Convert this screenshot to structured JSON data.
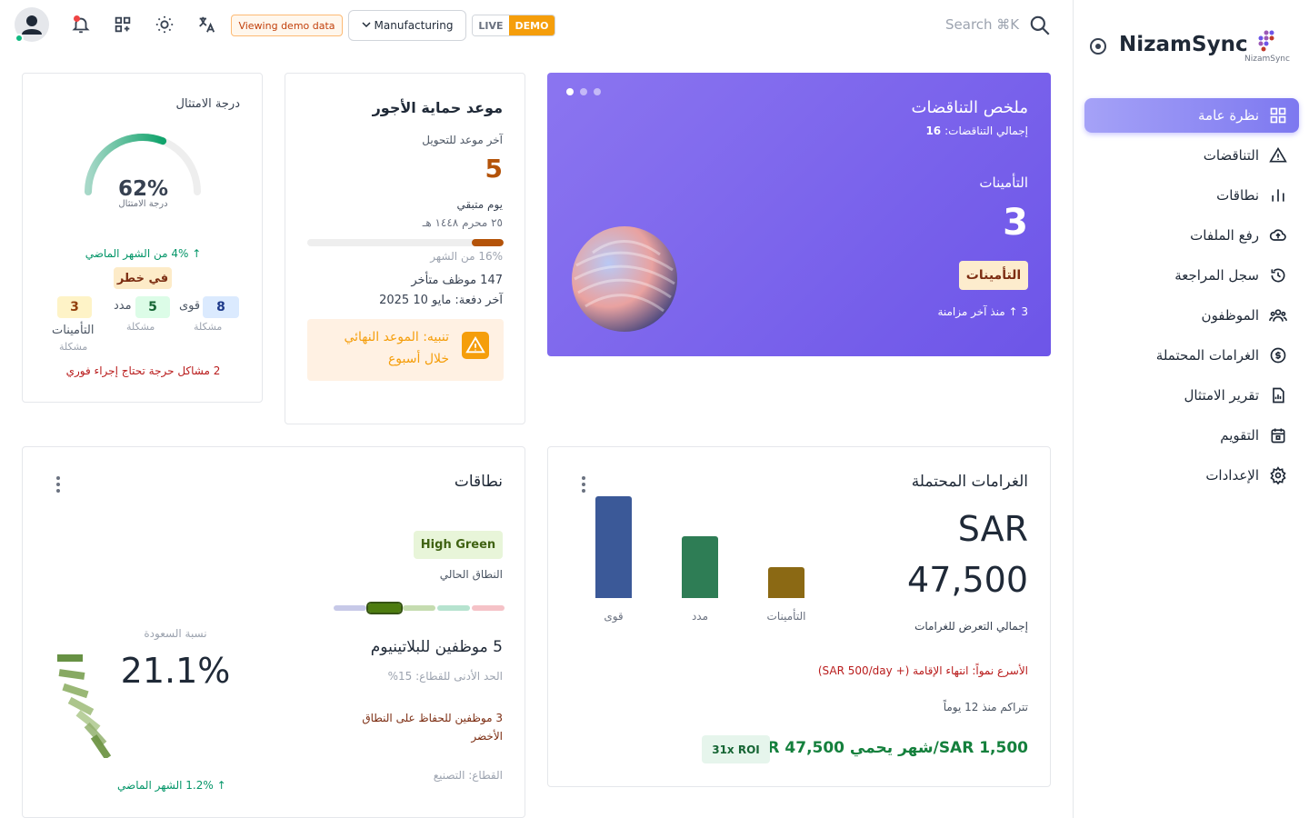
{
  "topbar": {
    "demo_chip": "Viewing demo data",
    "industry": "Manufacturing",
    "mode_live": "LIVE",
    "mode_demo": "DEMO",
    "search_placeholder": "Search ⌘K",
    "icons": [
      "user-icon",
      "bell-icon",
      "apps-icon",
      "sun-icon",
      "translate-icon",
      "search-icon"
    ]
  },
  "sidebar": {
    "brand": "NizamSync",
    "brand_logo_text": "NizamSync",
    "accent": "#7d78f0",
    "items": [
      {
        "label": "نظرة عامة",
        "icon": "dashboard-icon",
        "active": true
      },
      {
        "label": "التناقضات",
        "icon": "warning-icon"
      },
      {
        "label": "نطاقات",
        "icon": "bar-chart-icon"
      },
      {
        "label": "رفع الملفات",
        "icon": "cloud-upload-icon"
      },
      {
        "label": "سجل المراجعة",
        "icon": "history-icon"
      },
      {
        "label": "الموظفون",
        "icon": "users-icon"
      },
      {
        "label": "الغرامات المحتملة",
        "icon": "coin-icon"
      },
      {
        "label": "تقرير الامتثال",
        "icon": "report-icon"
      },
      {
        "label": "التقويم",
        "icon": "calendar-icon"
      },
      {
        "label": "الإعدادات",
        "icon": "settings-icon"
      }
    ]
  },
  "compliance": {
    "title": "درجة الامتثال",
    "score": "62%",
    "score_label": "درجة الامتثال",
    "score_value": 0.62,
    "trend": "↑ 4% من الشهر الماضي",
    "status": "في خطر",
    "stats": [
      {
        "value": "8",
        "name": "قوى",
        "sub": "مشكلة",
        "color": "#1e3a8a",
        "bg": "#dbeafe"
      },
      {
        "value": "5",
        "name": "مدد",
        "sub": "مشكلة",
        "color": "#166534",
        "bg": "#dcfce7"
      },
      {
        "value": "3",
        "name": "التأمينات",
        "sub": "مشكلة",
        "color": "#92400e",
        "bg": "#fef3c7"
      }
    ],
    "critical": "2 مشاكل حرجة تحتاج إجراء فوري"
  },
  "wage": {
    "title": "موعد حماية الأجور",
    "deadline_label": "آخر موعد للتحويل",
    "days": "5",
    "days_label": "يوم متبقي",
    "hijri_date": "٢٥ محرم ١٤٤٨ هـ",
    "progress": 0.16,
    "progress_label": "16% من الشهر",
    "late_employees": "147 موظف متأخر",
    "last_payment": "آخر دفعة: مايو 10 2025",
    "alert_line1": "تنبيه: الموعد النهائي",
    "alert_line2": "خلال أسبوع"
  },
  "violations": {
    "title": "ملخص التناقضات",
    "total_label": "إجمالي التناقضات:",
    "total": "16",
    "category": "التأمينات",
    "count": "3",
    "tag": "التأمينات",
    "since_sync": "3 ↑ منذ آخر مزامنة",
    "slides": 3,
    "active_slide": 0
  },
  "bands": {
    "title": "نطاقات",
    "band_badge": "High Green",
    "band_label": "النطاق الحالي",
    "band_segments": [
      "#c7c9e8",
      "#4d7c0f",
      "#c5dcb0",
      "#b6e3cf",
      "#f5c2c7"
    ],
    "active_segment": 1,
    "platinum": "5 موظفين للبلاتينيوم",
    "min_sector": "الحد الأدنى للقطاع: 15%",
    "maintain": "3 موظفين للحفاظ على النطاق الأخضر",
    "sector": "القطاع: التصنيع",
    "saudization_label": "نسبة السعودة",
    "saudization": "21.1%",
    "trend": "↑ 1.2% الشهر الماضي"
  },
  "fines": {
    "title": "الغرامات المحتملة",
    "currency": "SAR",
    "amount": "47,500",
    "amount_label": "إجمالي التعرض للغرامات",
    "fastest": "الأسرع نمواً: انتهاء الإقامة (+ SAR 500/day)",
    "accrual": "تتراكم منذ 12 يوماً",
    "roi": "31x ROI",
    "protect": "SAR 1,500/شهر يحمي SAR 47,500",
    "chart_data": {
      "type": "bar",
      "categories": [
        "قوى",
        "مدد",
        "التأمينات"
      ],
      "values": [
        100,
        61,
        30
      ],
      "colors": [
        "#3b5998",
        "#2e7d55",
        "#8b6914"
      ]
    }
  }
}
